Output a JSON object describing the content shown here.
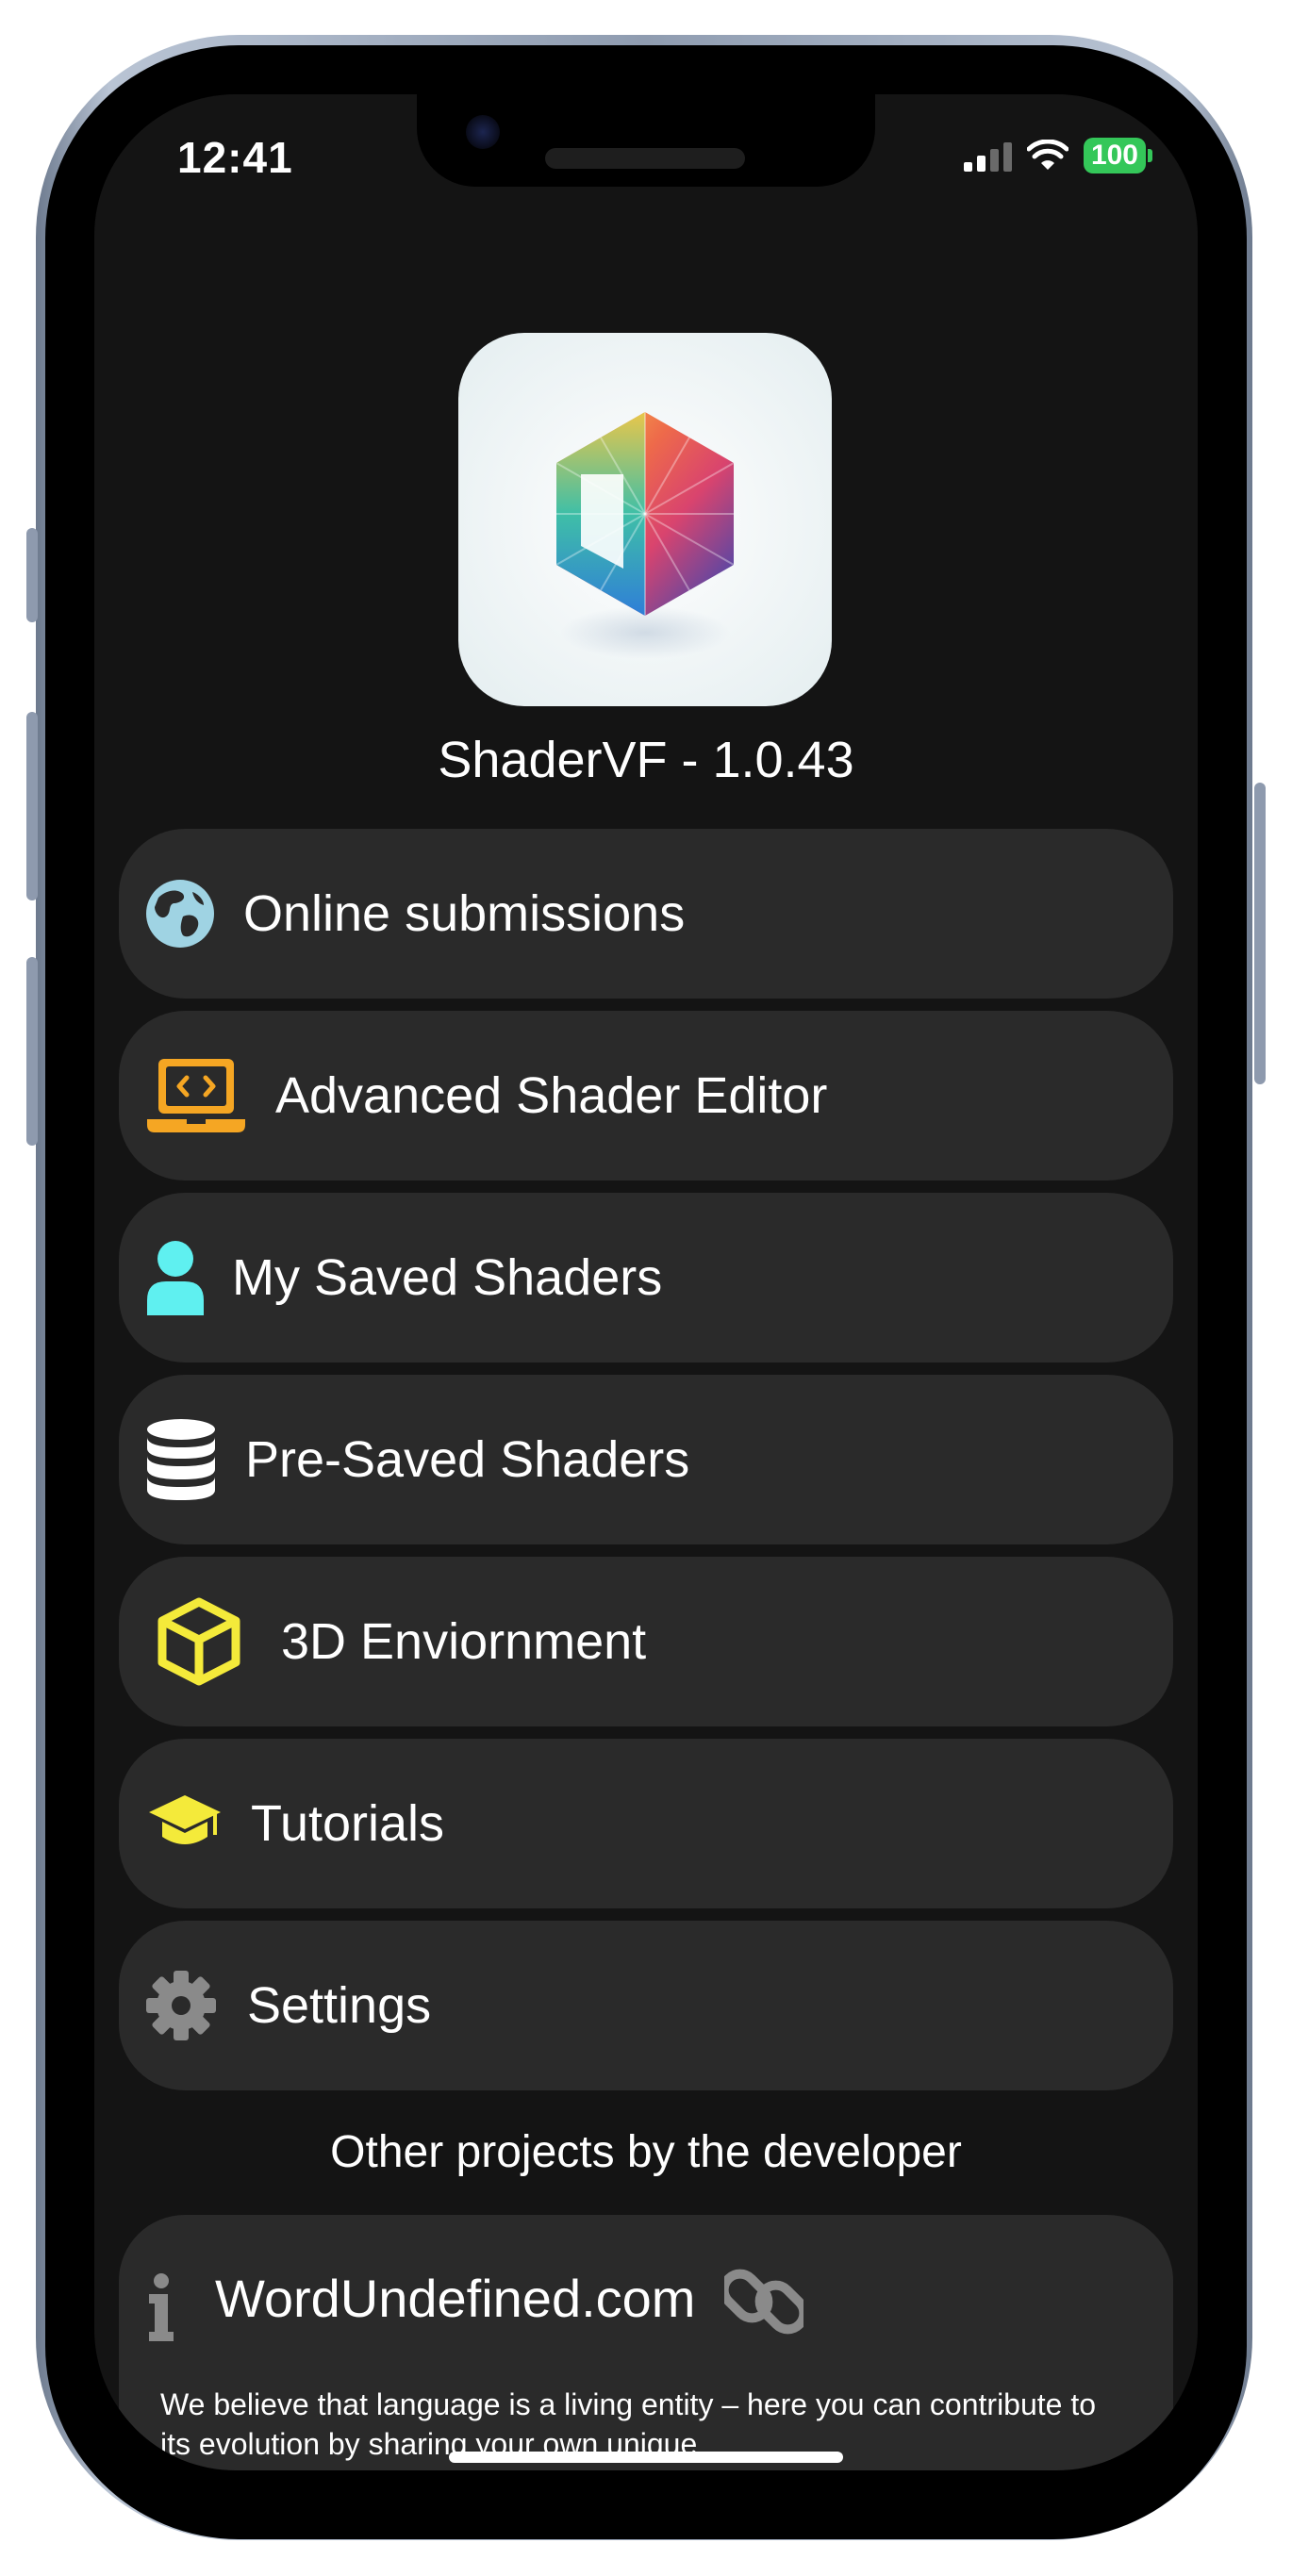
{
  "status_bar": {
    "time": "12:41",
    "battery": "100"
  },
  "app": {
    "version_text": "ShaderVF - 1.0.43"
  },
  "menu": [
    {
      "label": "Online submissions",
      "icon": "globe-icon",
      "color": "#9fd3e3"
    },
    {
      "label": "Advanced Shader Editor",
      "icon": "laptop-code-icon",
      "color": "#f5a623"
    },
    {
      "label": "My Saved Shaders",
      "icon": "user-icon",
      "color": "#5ff0f0"
    },
    {
      "label": "Pre-Saved Shaders",
      "icon": "database-icon",
      "color": "#ffffff"
    },
    {
      "label": "3D Enviornment",
      "icon": "cube-icon",
      "color": "#f4ea3a"
    },
    {
      "label": "Tutorials",
      "icon": "graduation-cap-icon",
      "color": "#f4ea3a"
    },
    {
      "label": "Settings",
      "icon": "gear-icon",
      "color": "#8a8a8a"
    }
  ],
  "other_projects": {
    "title": "Other projects by the developer",
    "items": [
      {
        "name": "WordUndefined.com",
        "description": "We believe that language is a living entity – here you can contribute to its evolution by sharing your own unique"
      }
    ]
  }
}
